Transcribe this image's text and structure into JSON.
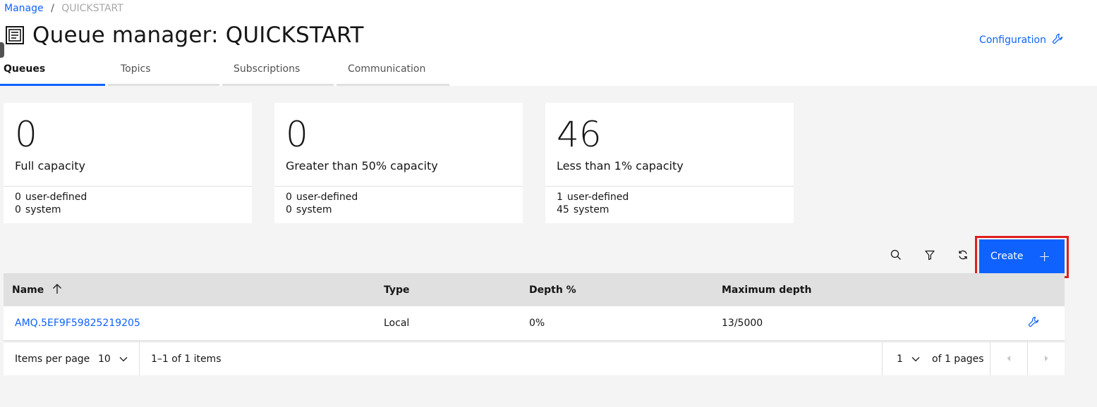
{
  "breadcrumb": {
    "parent": "Manage",
    "separator": "/",
    "current": "QUICKSTART"
  },
  "page": {
    "title": "Queue manager: QUICKSTART",
    "config_label": "Configuration"
  },
  "tabs": [
    {
      "label": "Queues",
      "active": true
    },
    {
      "label": "Topics",
      "active": false
    },
    {
      "label": "Subscriptions",
      "active": false
    },
    {
      "label": "Communication",
      "active": false
    }
  ],
  "cards": [
    {
      "value": "0",
      "caption": "Full capacity",
      "user_count": "0",
      "user_label": "user-defined",
      "system_count": "0",
      "system_label": "system"
    },
    {
      "value": "0",
      "caption": "Greater than 50% capacity",
      "user_count": "0",
      "user_label": "user-defined",
      "system_count": "0",
      "system_label": "system"
    },
    {
      "value": "46",
      "caption": "Less than 1% capacity",
      "user_count": "1",
      "user_label": "user-defined",
      "system_count": "45",
      "system_label": "system"
    }
  ],
  "toolbar": {
    "create_label": "Create",
    "create_plus": "+"
  },
  "table": {
    "headers": {
      "name": "Name",
      "type": "Type",
      "depth": "Depth %",
      "max_depth": "Maximum depth"
    },
    "rows": [
      {
        "name": "AMQ.5EF9F59825219205",
        "type": "Local",
        "depth": "0%",
        "max_depth": "13/5000"
      }
    ]
  },
  "pagination": {
    "items_per_page_label": "Items per page",
    "items_per_page_value": "10",
    "range_text": "1–1 of 1 items",
    "page_value": "1",
    "pages_text": "of 1 pages"
  },
  "colors": {
    "accent": "#0f62fe",
    "highlight": "#e01e1e",
    "background": "#f4f4f4"
  }
}
